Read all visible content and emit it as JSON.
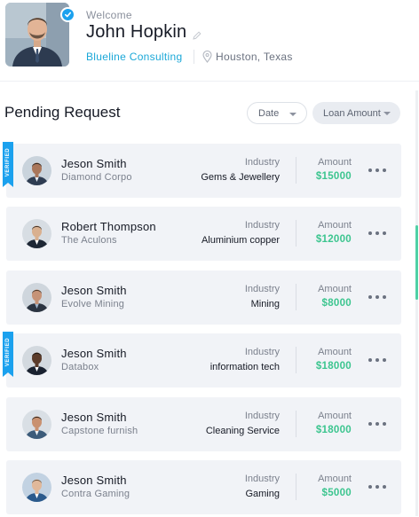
{
  "profile": {
    "welcome": "Welcome",
    "name": "John Hopkin",
    "company": "Blueline Consulting",
    "location": "Houston, Texas",
    "verified": true
  },
  "section": {
    "title": "Pending Request",
    "filters": {
      "date_label": "Date",
      "loan_label": "Loan Amount"
    }
  },
  "labels": {
    "industry": "Industry",
    "amount": "Amount",
    "verified": "VERIFIED"
  },
  "requests": [
    {
      "name": "Jeson Smith",
      "company": "Diamond Corpo",
      "industry": "Gems & Jewellery",
      "amount": "$15000",
      "verified": true
    },
    {
      "name": "Robert Thompson",
      "company": "The Aculons",
      "industry": "Aluminium copper",
      "amount": "$12000",
      "verified": false
    },
    {
      "name": "Jeson Smith",
      "company": "Evolve Mining",
      "industry": "Mining",
      "amount": "$8000",
      "verified": false
    },
    {
      "name": "Jeson Smith",
      "company": "Databox",
      "industry": "information tech",
      "amount": "$18000",
      "verified": true
    },
    {
      "name": "Jeson Smith",
      "company": "Capstone furnish",
      "industry": "Cleaning Service",
      "amount": "$18000",
      "verified": false
    },
    {
      "name": "Jeson Smith",
      "company": "Contra Gaming",
      "industry": "Gaming",
      "amount": "$5000",
      "verified": false
    }
  ],
  "colors": {
    "accent_blue": "#1ba1ee",
    "company_blue": "#1ba8d8",
    "amount_green": "#3cc58f",
    "card_bg": "#f1f3f7"
  },
  "icons": [
    "verified-check-icon",
    "edit-icon",
    "location-pin-icon",
    "caret-down-icon",
    "more-options-icon",
    "avatar"
  ]
}
